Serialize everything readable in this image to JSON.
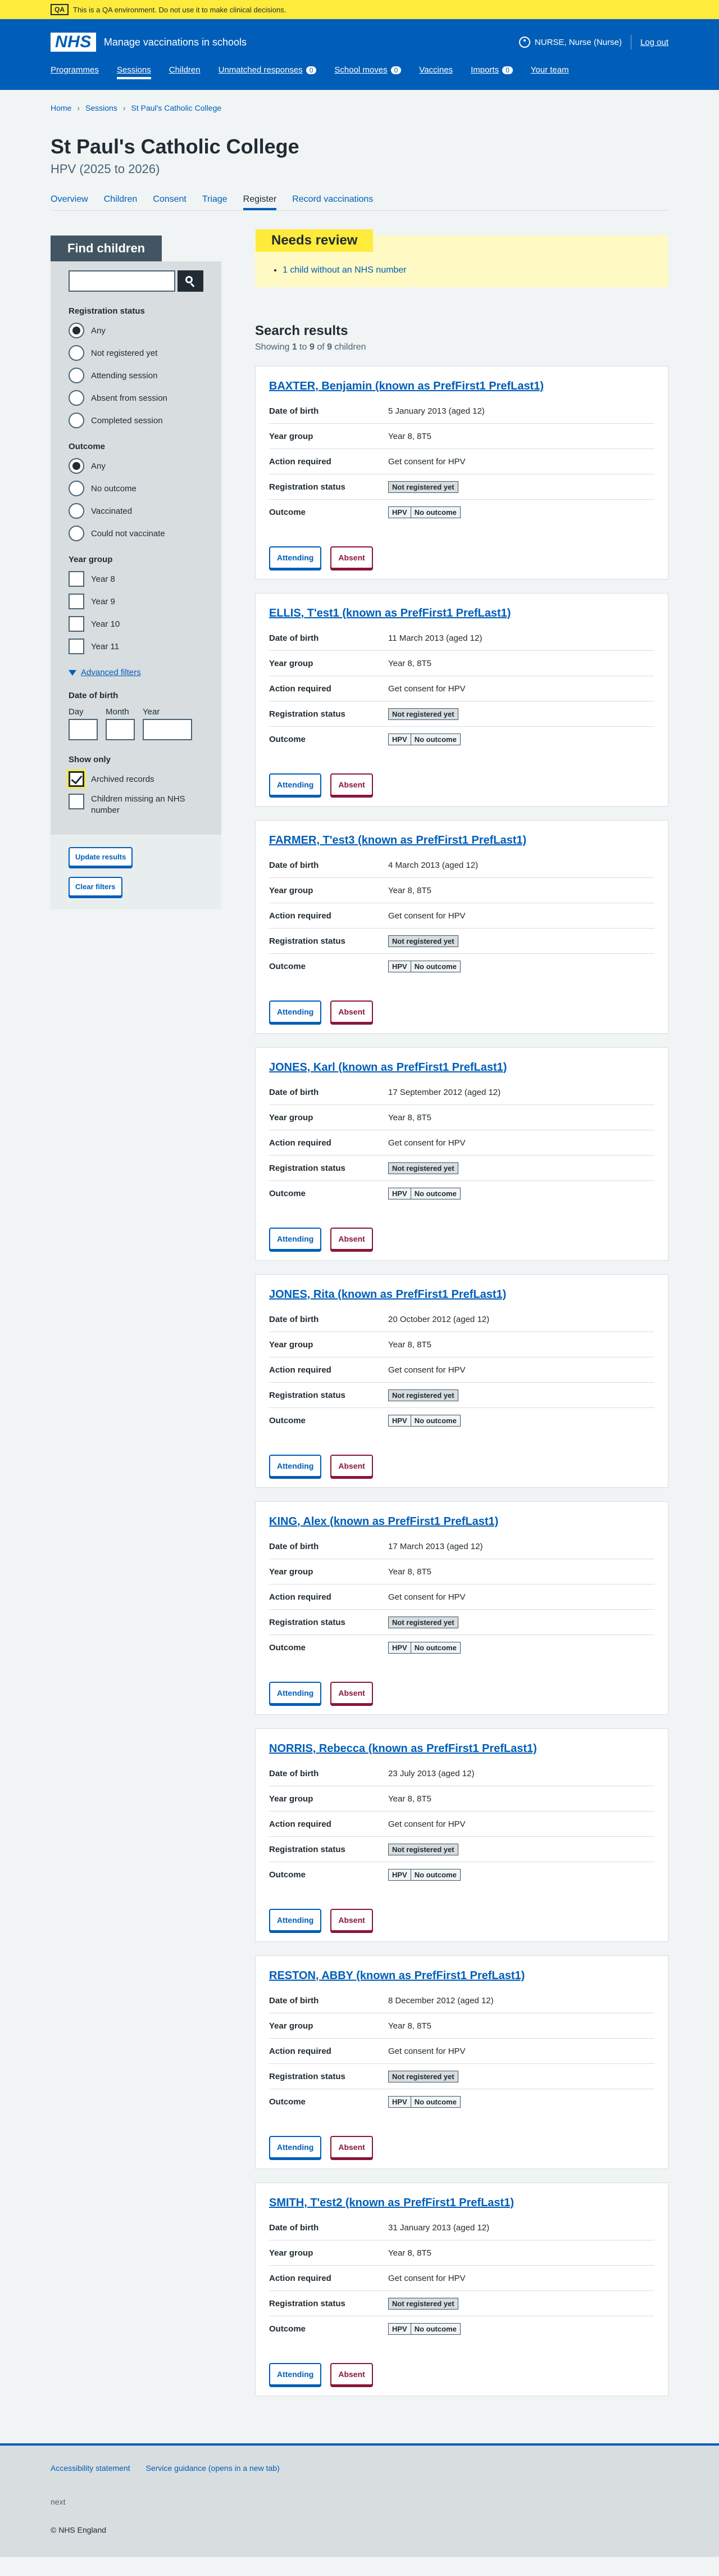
{
  "qa_banner": {
    "tag": "QA",
    "message": "This is a QA environment. Do not use it to make clinical decisions."
  },
  "header": {
    "logo": "NHS",
    "service_name": "Manage vaccinations in schools",
    "user": "NURSE, Nurse (Nurse)",
    "logout": "Log out",
    "nav": [
      {
        "label": "Programmes"
      },
      {
        "label": "Sessions"
      },
      {
        "label": "Children"
      },
      {
        "label": "Unmatched responses",
        "count": "0"
      },
      {
        "label": "School moves",
        "count": "0"
      },
      {
        "label": "Vaccines"
      },
      {
        "label": "Imports",
        "count": "0"
      },
      {
        "label": "Your team"
      }
    ]
  },
  "breadcrumb": [
    "Home",
    "Sessions",
    "St Paul's Catholic College"
  ],
  "page": {
    "title": "St Paul's Catholic College",
    "caption": "HPV (2025 to 2026)"
  },
  "sub_nav": [
    "Overview",
    "Children",
    "Consent",
    "Triage",
    "Register",
    "Record vaccinations"
  ],
  "filters": {
    "heading": "Find children",
    "registration_label": "Registration status",
    "registration_options": [
      "Any",
      "Not registered yet",
      "Attending session",
      "Absent from session",
      "Completed session"
    ],
    "outcome_label": "Outcome",
    "outcome_options": [
      "Any",
      "No outcome",
      "Vaccinated",
      "Could not vaccinate"
    ],
    "year_label": "Year group",
    "year_options": [
      "Year 8",
      "Year 9",
      "Year 10",
      "Year 11"
    ],
    "advanced_label": "Advanced filters",
    "dob_label": "Date of birth",
    "dob_day": "Day",
    "dob_month": "Month",
    "dob_year": "Year",
    "show_only_label": "Show only",
    "archived": "Archived records",
    "missing_nhs": "Children missing an NHS number",
    "update_button": "Update results",
    "clear_button": "Clear filters"
  },
  "needs_review": {
    "heading": "Needs review",
    "link": "1 child without an NHS number"
  },
  "results": {
    "title": "Search results",
    "count_prefix": "Showing ",
    "count_from": "1",
    "count_to_word": " to ",
    "count_to": "9",
    "count_of_word": " of ",
    "count_total": "9",
    "count_suffix": " children"
  },
  "labels": {
    "dob": "Date of birth",
    "year": "Year group",
    "action": "Action required",
    "registration": "Registration status",
    "outcome": "Outcome",
    "attending": "Attending",
    "absent": "Absent"
  },
  "children": [
    {
      "name": "BAXTER, Benjamin (known as PrefFirst1 PrefLast1)",
      "dob": "5 January 2013 (aged 12)",
      "year": "Year 8, 8T5",
      "action": "Get consent for HPV",
      "registration": "Not registered yet",
      "programme": "HPV",
      "outcome": "No outcome"
    },
    {
      "name": "ELLIS, T'est1 (known as PrefFirst1 PrefLast1)",
      "dob": "11 March 2013 (aged 12)",
      "year": "Year 8, 8T5",
      "action": "Get consent for HPV",
      "registration": "Not registered yet",
      "programme": "HPV",
      "outcome": "No outcome"
    },
    {
      "name": "FARMER, T'est3 (known as PrefFirst1 PrefLast1)",
      "dob": "4 March 2013 (aged 12)",
      "year": "Year 8, 8T5",
      "action": "Get consent for HPV",
      "registration": "Not registered yet",
      "programme": "HPV",
      "outcome": "No outcome"
    },
    {
      "name": "JONES, Karl (known as PrefFirst1 PrefLast1)",
      "dob": "17 September 2012 (aged 12)",
      "year": "Year 8, 8T5",
      "action": "Get consent for HPV",
      "registration": "Not registered yet",
      "programme": "HPV",
      "outcome": "No outcome"
    },
    {
      "name": "JONES, Rita (known as PrefFirst1 PrefLast1)",
      "dob": "20 October 2012 (aged 12)",
      "year": "Year 8, 8T5",
      "action": "Get consent for HPV",
      "registration": "Not registered yet",
      "programme": "HPV",
      "outcome": "No outcome"
    },
    {
      "name": "KING, Alex (known as PrefFirst1 PrefLast1)",
      "dob": "17 March 2013 (aged 12)",
      "year": "Year 8, 8T5",
      "action": "Get consent for HPV",
      "registration": "Not registered yet",
      "programme": "HPV",
      "outcome": "No outcome"
    },
    {
      "name": "NORRIS, Rebecca (known as PrefFirst1 PrefLast1)",
      "dob": "23 July 2013 (aged 12)",
      "year": "Year 8, 8T5",
      "action": "Get consent for HPV",
      "registration": "Not registered yet",
      "programme": "HPV",
      "outcome": "No outcome"
    },
    {
      "name": "RESTON, ABBY (known as PrefFirst1 PrefLast1)",
      "dob": "8 December 2012 (aged 12)",
      "year": "Year 8, 8T5",
      "action": "Get consent for HPV",
      "registration": "Not registered yet",
      "programme": "HPV",
      "outcome": "No outcome"
    },
    {
      "name": "SMITH, T'est2 (known as PrefFirst1 PrefLast1)",
      "dob": "31 January 2013 (aged 12)",
      "year": "Year 8, 8T5",
      "action": "Get consent for HPV",
      "registration": "Not registered yet",
      "programme": "HPV",
      "outcome": "No outcome"
    }
  ],
  "footer": {
    "links": [
      "Accessibility statement",
      "Service guidance (opens in a new tab)"
    ],
    "version": "next",
    "copyright": "© NHS England"
  }
}
